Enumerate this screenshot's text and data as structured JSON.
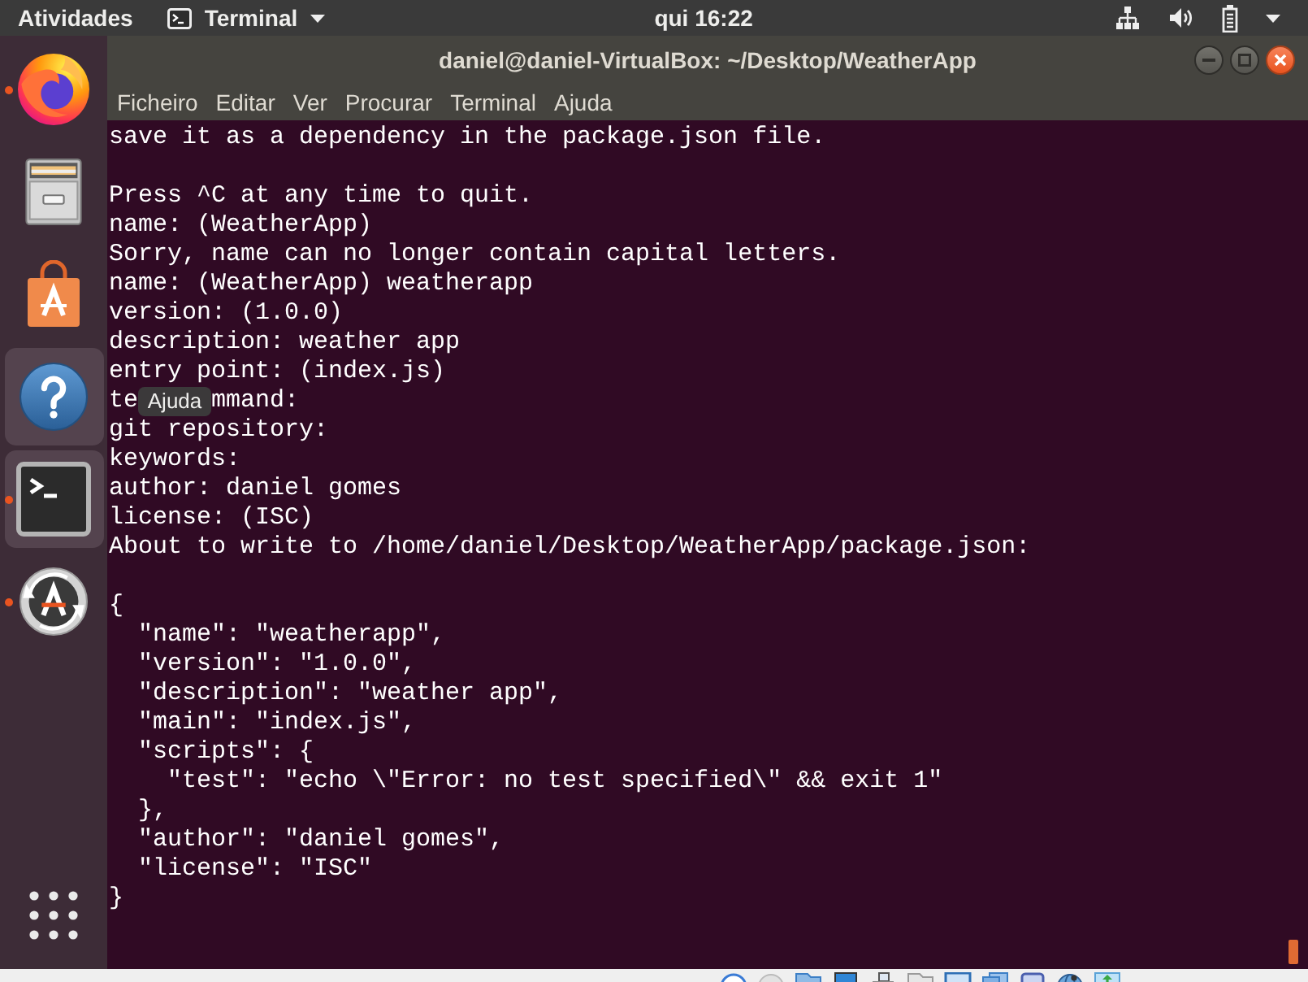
{
  "top_bar": {
    "activities": "Atividades",
    "app_menu": {
      "label": "Terminal"
    },
    "clock": "qui 16:22"
  },
  "dock": {
    "items": [
      {
        "kind": "browser",
        "running": true,
        "highlighted": false
      },
      {
        "kind": "files",
        "running": false,
        "highlighted": false
      },
      {
        "kind": "store",
        "running": false,
        "highlighted": false
      },
      {
        "kind": "help",
        "running": false,
        "highlighted": true,
        "tooltip": "Ajuda"
      },
      {
        "kind": "terminal",
        "running": true,
        "highlighted": true
      },
      {
        "kind": "updater",
        "running": true,
        "highlighted": false
      }
    ]
  },
  "window": {
    "title": "daniel@daniel-VirtualBox: ~/Desktop/WeatherApp",
    "menu": [
      "Ficheiro",
      "Editar",
      "Ver",
      "Procurar",
      "Terminal",
      "Ajuda"
    ]
  },
  "terminal": {
    "lines": [
      {
        "kind": "text",
        "text": "save it as a dependency in the package.json file."
      },
      {
        "kind": "blank"
      },
      {
        "kind": "text",
        "text": "Press ^C at any time to quit."
      },
      {
        "kind": "text",
        "text": "name: (WeatherApp)"
      },
      {
        "kind": "text",
        "text": "Sorry, name can no longer contain capital letters."
      },
      {
        "kind": "text",
        "text": "name: (WeatherApp) weatherapp"
      },
      {
        "kind": "text",
        "text": "version: (1.0.0)"
      },
      {
        "kind": "text",
        "text": "description: weather app"
      },
      {
        "kind": "text",
        "text": "entry point: (index.js)"
      },
      {
        "kind": "covered",
        "parts": [
          "te",
          "mmand:"
        ]
      },
      {
        "kind": "text",
        "text": "git repository:"
      },
      {
        "kind": "text",
        "text": "keywords:"
      },
      {
        "kind": "text",
        "text": "author: daniel gomes"
      },
      {
        "kind": "text",
        "text": "license: (ISC)"
      },
      {
        "kind": "text",
        "text": "About to write to /home/daniel/Desktop/WeatherApp/package.json:"
      },
      {
        "kind": "blank"
      },
      {
        "kind": "text",
        "text": "{"
      },
      {
        "kind": "text",
        "text": "  \"name\": \"weatherapp\","
      },
      {
        "kind": "text",
        "text": "  \"version\": \"1.0.0\","
      },
      {
        "kind": "text",
        "text": "  \"description\": \"weather app\","
      },
      {
        "kind": "text",
        "text": "  \"main\": \"index.js\","
      },
      {
        "kind": "text",
        "text": "  \"scripts\": {"
      },
      {
        "kind": "text",
        "text": "    \"test\": \"echo \\\"Error: no test specified\\\" && exit 1\""
      },
      {
        "kind": "text",
        "text": "  },"
      },
      {
        "kind": "text",
        "text": "  \"author\": \"daniel gomes\","
      },
      {
        "kind": "text",
        "text": "  \"license\": \"ISC\""
      },
      {
        "kind": "text",
        "text": "}"
      }
    ]
  }
}
